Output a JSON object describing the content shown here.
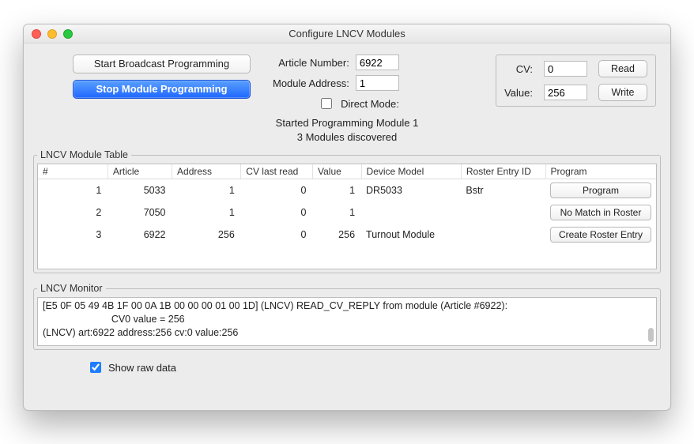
{
  "window_title": "Configure LNCV Modules",
  "buttons": {
    "start_broadcast": "Start Broadcast Programming",
    "stop_module": "Stop Module Programming"
  },
  "fields": {
    "article_label": "Article Number:",
    "article_value": "6922",
    "module_addr_label": "Module Address:",
    "module_addr_value": "1",
    "direct_mode_label": "Direct Mode:"
  },
  "cv_panel": {
    "cv_label": "CV:",
    "cv_value": "0",
    "value_label": "Value:",
    "value_value": "256",
    "read_label": "Read",
    "write_label": "Write"
  },
  "status_line1": "Started Programming Module 1",
  "status_line2": "3 Modules discovered",
  "table": {
    "legend": "LNCV Module Table",
    "headers": {
      "num": "#",
      "article": "Article",
      "address": "Address",
      "cvlast": "CV last read",
      "value": "Value",
      "model": "Device Model",
      "roster": "Roster Entry ID",
      "program": "Program"
    },
    "rows": [
      {
        "num": "1",
        "article": "5033",
        "address": "1",
        "cvlast": "0",
        "value": "1",
        "model": "DR5033",
        "roster": "Bstr",
        "btn": "Program"
      },
      {
        "num": "2",
        "article": "7050",
        "address": "1",
        "cvlast": "0",
        "value": "1",
        "model": "",
        "roster": "",
        "btn": "No Match in Roster"
      },
      {
        "num": "3",
        "article": "6922",
        "address": "256",
        "cvlast": "0",
        "value": "256",
        "model": "Turnout Module",
        "roster": "",
        "btn": "Create Roster Entry"
      }
    ]
  },
  "monitor": {
    "legend": "LNCV Monitor",
    "text": "[E5 0F 05 49 4B 1F 00 0A 1B 00 00 00 01 00 1D] (LNCV) READ_CV_REPLY from module (Article #6922):\n                         CV0 value = 256\n(LNCV) art:6922 address:256 cv:0 value:256"
  },
  "show_raw_label": "Show raw data"
}
